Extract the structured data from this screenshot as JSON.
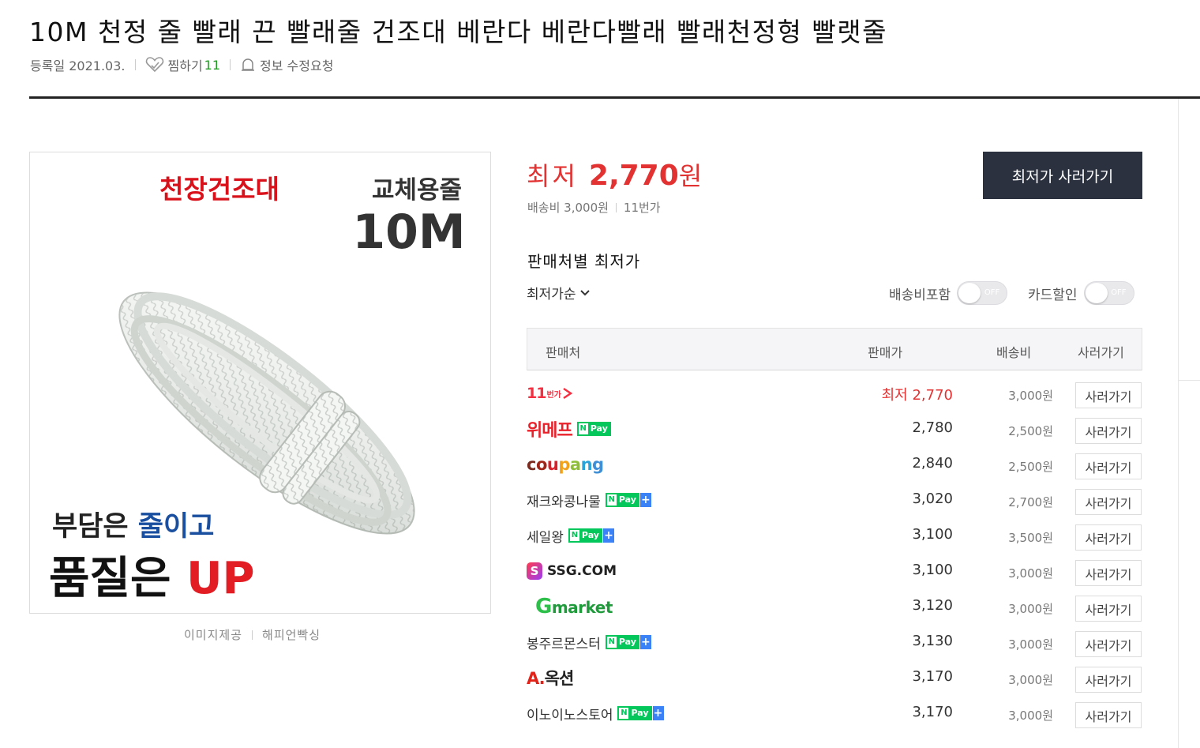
{
  "product": {
    "title": "10M 천정 줄 빨래 끈 빨래줄 건조대 베란다 베란다빨래 빨래천정형 빨랫줄",
    "registered": "등록일 2021.03.",
    "wish_label": "찜하기",
    "wish_count": "11",
    "edit_request": "정보 수정요청"
  },
  "image": {
    "headline_red": "천장건조대",
    "headline_dark": "교체용줄",
    "length_text": "10M",
    "slogan_line1_a": "부담은 ",
    "slogan_line1_b": "줄이고",
    "slogan_line2_a": "품질은 ",
    "slogan_line2_b": "UP",
    "credit_label": "이미지제공",
    "credit_value": "해피언빡싱"
  },
  "pricing": {
    "lowest_label": "최저",
    "lowest_value": "2,770",
    "lowest_unit": "원",
    "shipping": "배송비 3,000원",
    "store": "11번가",
    "buy_button": "최저가 사러가기"
  },
  "sellers_section": {
    "title": "판매처별 최저가",
    "sort_label": "최저가순",
    "toggle_shipping_label": "배송비포함",
    "toggle_card_label": "카드할인",
    "toggle_state": "OFF"
  },
  "table": {
    "headers": {
      "seller": "판매처",
      "price": "판매가",
      "shipping": "배송비",
      "go": "사러가기"
    },
    "rows": [
      {
        "seller": "11번가",
        "price": "최저 2,770",
        "shipping": "3,000원",
        "go": "사러가기"
      },
      {
        "seller": "위메프",
        "npay": "Pay",
        "price": "2,780",
        "shipping": "2,500원",
        "go": "사러가기"
      },
      {
        "seller": "coupang",
        "price": "2,840",
        "shipping": "2,500원",
        "go": "사러가기"
      },
      {
        "seller": "재크와콩나물",
        "npay": "Pay",
        "price": "3,020",
        "shipping": "2,700원",
        "go": "사러가기"
      },
      {
        "seller": "세일왕",
        "npay": "Pay",
        "price": "3,100",
        "shipping": "3,500원",
        "go": "사러가기"
      },
      {
        "seller": "SSG.COM",
        "price": "3,100",
        "shipping": "3,000원",
        "go": "사러가기"
      },
      {
        "seller": "Gmarket",
        "price": "3,120",
        "shipping": "3,000원",
        "go": "사러가기"
      },
      {
        "seller": "봉주르몬스터",
        "npay": "Pay",
        "price": "3,130",
        "shipping": "3,000원",
        "go": "사러가기"
      },
      {
        "seller": "옥션",
        "price": "3,170",
        "shipping": "3,000원",
        "go": "사러가기"
      },
      {
        "seller": "이노이노스토어",
        "npay": "Pay",
        "price": "3,170",
        "shipping": "3,000원",
        "go": "사러가기"
      }
    ]
  },
  "colors": {
    "accent_red": "#e23232",
    "button_dark": "#2c3140",
    "npay_green": "#03c75a",
    "wish_count_green": "#20a020"
  },
  "icons": [
    "heart-icon",
    "bell-icon",
    "chevron-down-icon"
  ]
}
